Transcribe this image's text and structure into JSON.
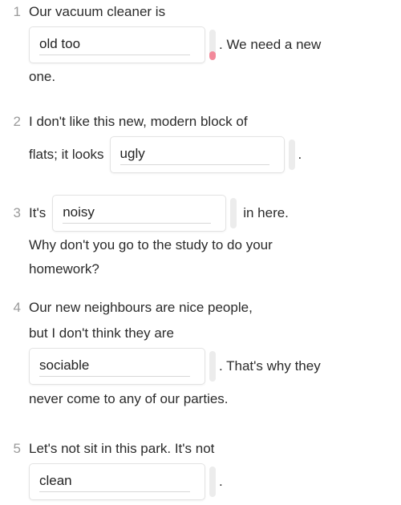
{
  "page": {
    "background_color": "#ffffff",
    "text_color": "#2b2b2b",
    "number_color": "#9a9a9a",
    "input_border_color": "#e3e3e3",
    "markbar_color": "#ececec",
    "markbar_fill_color": "#f2899a"
  },
  "exercise": {
    "items": [
      {
        "number": "1",
        "pre_text": "Our vacuum cleaner is",
        "answer": {
          "value": "old too",
          "placeholder": "",
          "marker_fill_percent": 28
        },
        "post_text": ". We need a new",
        "tail_text": "one."
      },
      {
        "number": "2",
        "pre_text": "I don't like this new, modern block of",
        "pre_text_2": "flats; it looks",
        "answer": {
          "value": "ugly",
          "placeholder": "",
          "marker_fill_percent": 0
        },
        "post_text": ".",
        "tail_text": ""
      },
      {
        "number": "3",
        "pre_text": "It's",
        "answer": {
          "value": "noisy",
          "placeholder": "",
          "marker_fill_percent": 0
        },
        "post_text": "in here.",
        "tail_text": "Why don't you go to the study to do your",
        "tail_text_2": "homework?"
      },
      {
        "number": "4",
        "pre_text": "Our new neighbours are nice people,",
        "pre_text_2": "but I don't think they are",
        "answer": {
          "value": "sociable",
          "placeholder": "",
          "marker_fill_percent": 0
        },
        "post_text": ". That's why they",
        "tail_text": "never come to any of our parties."
      },
      {
        "number": "5",
        "pre_text": "Let's not sit in this park. It's not",
        "answer": {
          "value": "clean",
          "placeholder": "",
          "marker_fill_percent": 0
        },
        "post_text": ".",
        "tail_text": ""
      }
    ]
  }
}
